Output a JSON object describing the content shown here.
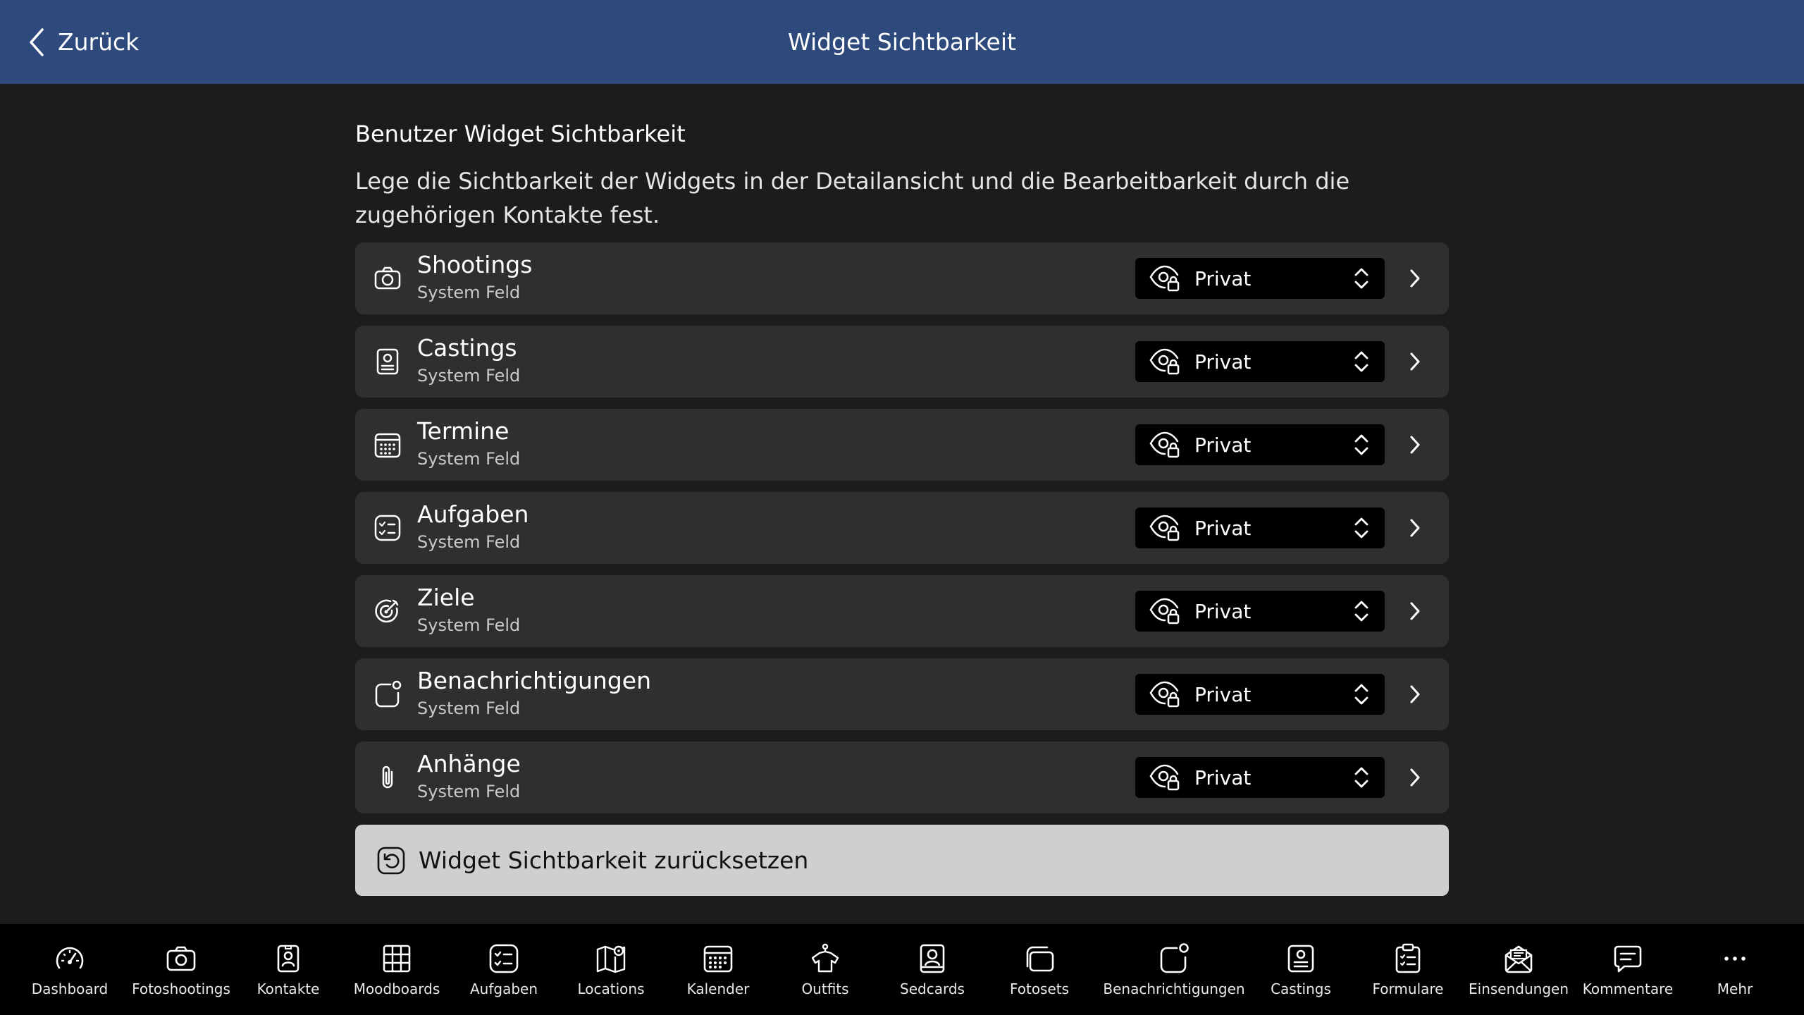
{
  "header": {
    "back_label": "Zurück",
    "title": "Widget Sichtbarkeit",
    "background": "#2e4a7d"
  },
  "section": {
    "title": "Benutzer Widget Sichtbarkeit",
    "description": "Lege die Sichtbarkeit der Widgets in der Detailansicht und die Bearbeitbarkeit durch die zugehörigen Kontakte fest."
  },
  "widgets": [
    {
      "title": "Shootings",
      "subtitle": "System Feld",
      "icon": "camera-icon",
      "visibility": "Privat"
    },
    {
      "title": "Castings",
      "subtitle": "System Feld",
      "icon": "badge-icon",
      "visibility": "Privat"
    },
    {
      "title": "Termine",
      "subtitle": "System Feld",
      "icon": "calendar-icon",
      "visibility": "Privat"
    },
    {
      "title": "Aufgaben",
      "subtitle": "System Feld",
      "icon": "checklist-icon",
      "visibility": "Privat"
    },
    {
      "title": "Ziele",
      "subtitle": "System Feld",
      "icon": "target-icon",
      "visibility": "Privat"
    },
    {
      "title": "Benachrichtigungen",
      "subtitle": "System Feld",
      "icon": "notification-icon",
      "visibility": "Privat"
    },
    {
      "title": "Anhänge",
      "subtitle": "System Feld",
      "icon": "paperclip-icon",
      "visibility": "Privat"
    }
  ],
  "reset": {
    "label": "Widget Sichtbarkeit zurücksetzen",
    "icon": "reset-icon"
  },
  "tabbar": {
    "items": [
      {
        "label": "Dashboard",
        "icon": "gauge-icon"
      },
      {
        "label": "Fotoshootings",
        "icon": "camera-icon"
      },
      {
        "label": "Kontakte",
        "icon": "contact-icon"
      },
      {
        "label": "Moodboards",
        "icon": "grid-icon"
      },
      {
        "label": "Aufgaben",
        "icon": "checklist-icon"
      },
      {
        "label": "Locations",
        "icon": "map-pin-icon"
      },
      {
        "label": "Kalender",
        "icon": "calendar-icon"
      },
      {
        "label": "Outfits",
        "icon": "shirt-icon"
      },
      {
        "label": "Sedcards",
        "icon": "portrait-icon"
      },
      {
        "label": "Fotosets",
        "icon": "photo-stack-icon"
      },
      {
        "label": "Benachrichtigungen",
        "icon": "notification-icon"
      },
      {
        "label": "Castings",
        "icon": "badge-icon"
      },
      {
        "label": "Formulare",
        "icon": "clipboard-icon"
      },
      {
        "label": "Einsendungen",
        "icon": "mail-icon"
      },
      {
        "label": "Kommentare",
        "icon": "comment-icon"
      },
      {
        "label": "Mehr",
        "icon": "more-icon"
      }
    ]
  }
}
